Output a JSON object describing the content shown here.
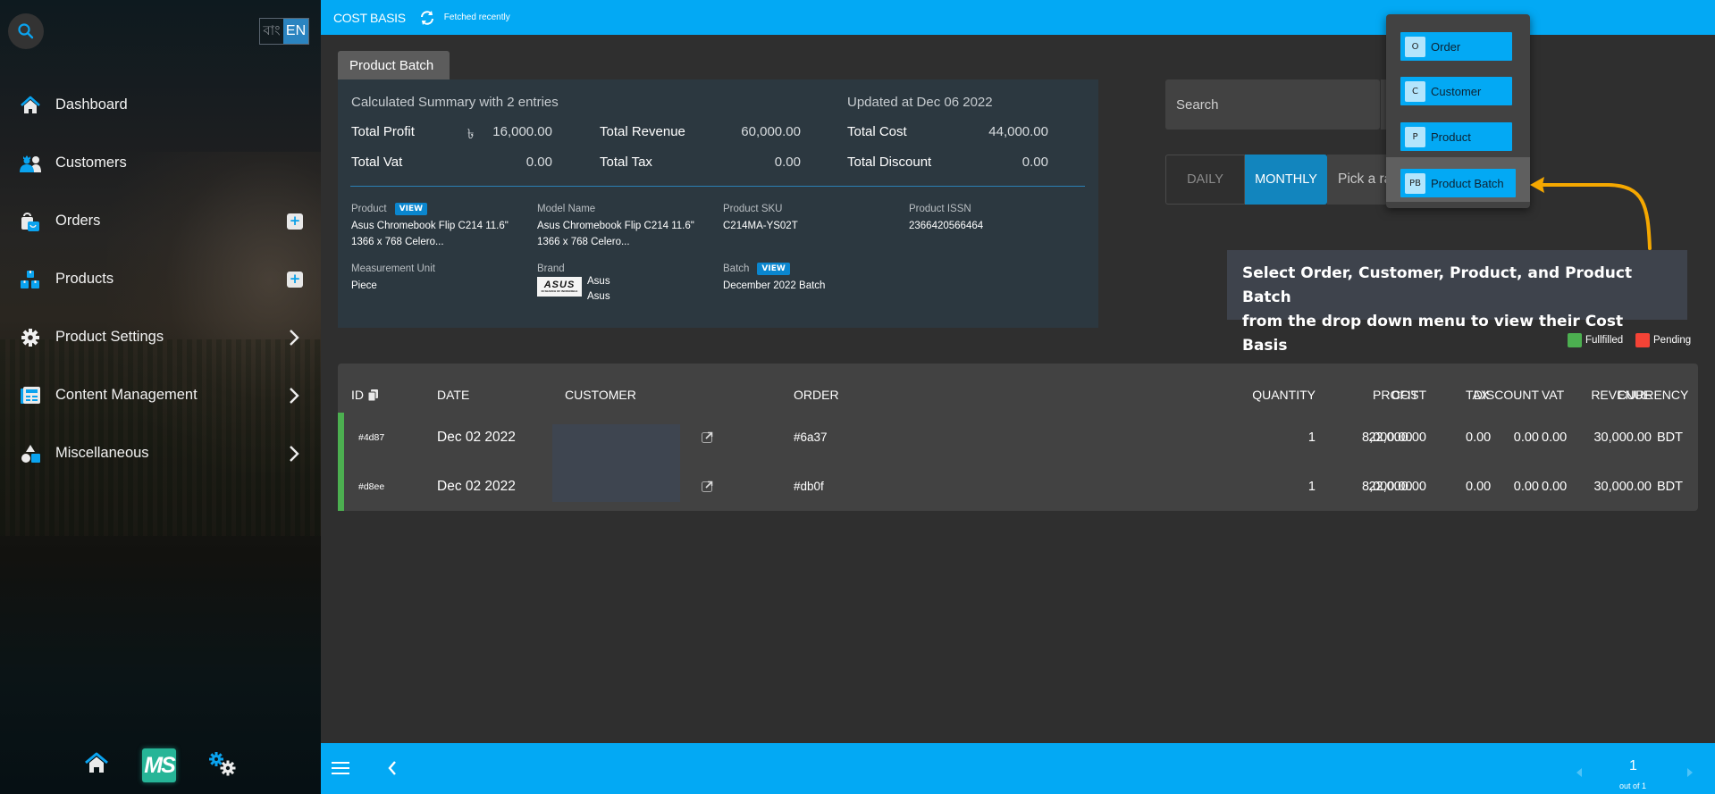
{
  "sidebar": {
    "language": {
      "bn": "বাং",
      "en": "EN",
      "active": "EN"
    },
    "items": [
      {
        "label": "Dashboard",
        "icon": "home-icon",
        "action": null
      },
      {
        "label": "Customers",
        "icon": "customers-icon",
        "action": null
      },
      {
        "label": "Orders",
        "icon": "shopping-bag-icon",
        "action": "plus"
      },
      {
        "label": "Products",
        "icon": "boxes-icon",
        "action": "plus"
      },
      {
        "label": "Product Settings",
        "icon": "gear-icon",
        "action": "chevron"
      },
      {
        "label": "Content Management",
        "icon": "newspaper-icon",
        "action": "chevron"
      },
      {
        "label": "Miscellaneous",
        "icon": "shapes-icon",
        "action": "chevron"
      }
    ],
    "bottom": {
      "logo_text": "MS"
    }
  },
  "topbar": {
    "title": "COST BASIS",
    "status": "Fetched recently"
  },
  "summary": {
    "tab_label": "Product Batch",
    "caption": "Calculated Summary with 2 entries",
    "updated": "Updated at Dec 06 2022",
    "currency_symbol": "৳",
    "totals": {
      "profit_label": "Total Profit",
      "profit": "16,000.00",
      "revenue_label": "Total Revenue",
      "revenue": "60,000.00",
      "cost_label": "Total Cost",
      "cost": "44,000.00",
      "vat_label": "Total Vat",
      "vat": "0.00",
      "tax_label": "Total Tax",
      "tax": "0.00",
      "discount_label": "Total Discount",
      "discount": "0.00"
    },
    "details": {
      "product_label": "Product",
      "product_view": "VIEW",
      "product_value_1": "Asus Chromebook Flip C214 11.6\"",
      "product_value_2": "1366 x 768 Celero...",
      "model_label": "Model Name",
      "model_value_1": "Asus Chromebook Flip C214 11.6\"",
      "model_value_2": "1366 x 768 Celero...",
      "sku_label": "Product SKU",
      "sku_value": "C214MA-YS02T",
      "issn_label": "Product ISSN",
      "issn_value": "2366420566464",
      "unit_label": "Measurement Unit",
      "unit_value": "Piece",
      "brand_label": "Brand",
      "brand_logo": "ASUS",
      "brand_value_1": "Asus",
      "brand_value_2": "Asus",
      "batch_label": "Batch",
      "batch_view": "VIEW",
      "batch_value": "December 2022 Batch"
    }
  },
  "controls": {
    "search_placeholder": "Search",
    "range": {
      "daily": "DAILY",
      "monthly": "MONTHLY",
      "active": "MONTHLY",
      "picker_placeholder": "Pick a ra"
    }
  },
  "dropdown": {
    "items": [
      {
        "abbr": "O",
        "label": "Order"
      },
      {
        "abbr": "C",
        "label": "Customer"
      },
      {
        "abbr": "P",
        "label": "Product"
      },
      {
        "abbr": "PB",
        "label": "Product Batch"
      }
    ],
    "selected": "Product Batch"
  },
  "annotation": {
    "line1": "Select Order, Customer, Product, and Product Batch",
    "line2": "from the drop down menu to view their Cost Basis",
    "arrow_color": "#f5a800"
  },
  "legend": {
    "fulfilled": {
      "label": "Fullfilled",
      "color": "#4caf50"
    },
    "pending": {
      "label": "Pending",
      "color": "#f44336"
    }
  },
  "table": {
    "headers": [
      "ID",
      "DATE",
      "CUSTOMER",
      "ORDER",
      "QUANTITY",
      "COST",
      "DISCOUNT",
      "REVENUE",
      "PROFIT",
      "TAX",
      "VAT",
      "CURRENCY"
    ],
    "rows": [
      {
        "id": "#4d87",
        "date": "Dec 02 2022",
        "customer": "",
        "order": "#6a37",
        "quantity": "1",
        "cost": "22,000.00",
        "discount": "0.00",
        "revenue": "30,000.00",
        "profit": "8,000.00",
        "tax": "0.00",
        "vat": "0.00",
        "currency": "BDT",
        "status": "fulfilled"
      },
      {
        "id": "#d8ee",
        "date": "Dec 02 2022",
        "customer": "",
        "order": "#db0f",
        "quantity": "1",
        "cost": "22,000.00",
        "discount": "0.00",
        "revenue": "30,000.00",
        "profit": "8,000.00",
        "tax": "0.00",
        "vat": "0.00",
        "currency": "BDT",
        "status": "fulfilled"
      }
    ]
  },
  "pagination": {
    "current": "1",
    "of_text": "out of 1"
  },
  "colors": {
    "brand": "#03a9f4",
    "active_tab": "#1285be",
    "summary_bg": "#2c3840",
    "fulfilled": "#4caf50",
    "pending": "#f44336"
  }
}
